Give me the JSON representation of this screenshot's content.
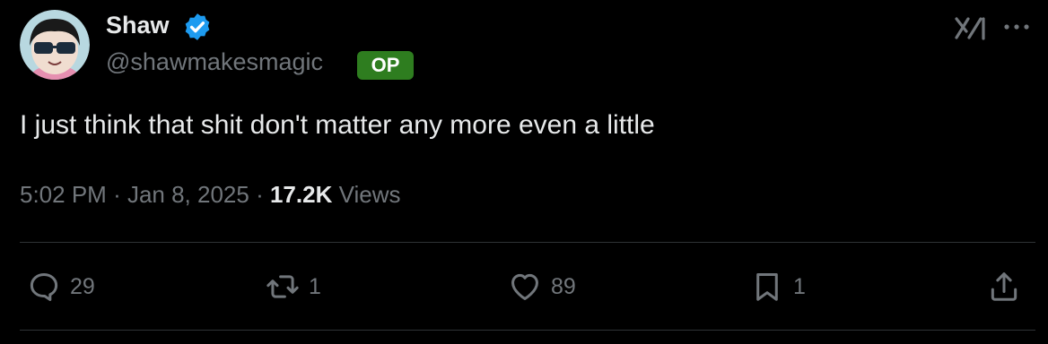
{
  "author": {
    "name": "Shaw",
    "handle": "@shawmakesmagic",
    "badge": "OP",
    "verified_color": "#1d9bf0"
  },
  "header_icons": [
    "grok-icon",
    "more-icon"
  ],
  "tweet": {
    "text": "I just think that shit don't matter any more even a little",
    "time": "5:02 PM",
    "date": "Jan 8, 2025",
    "views_count": "17.2K",
    "views_label": "Views"
  },
  "actions": {
    "replies": "29",
    "reposts": "1",
    "likes": "89",
    "bookmarks": "1"
  },
  "colors": {
    "background": "#000000",
    "text": "#e7e9ea",
    "muted": "#71767b",
    "op_badge": "#2e7d1f"
  }
}
